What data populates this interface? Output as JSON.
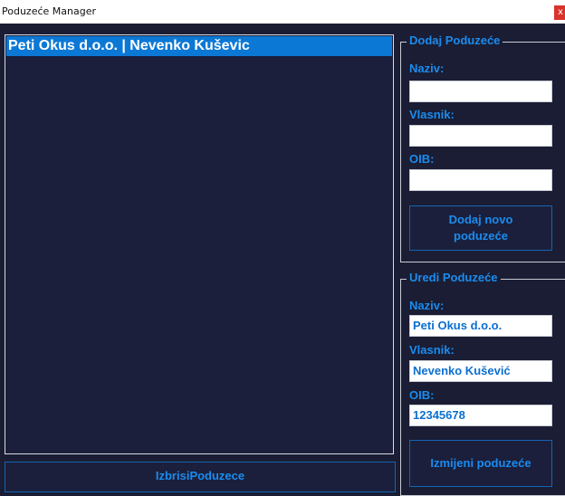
{
  "window": {
    "title": "Poduzeće Manager",
    "close_glyph": "x"
  },
  "companies_list": {
    "items": [
      {
        "label": "Peti Okus d.o.o. | Nevenko Kuševic"
      }
    ]
  },
  "delete_button": {
    "label": "IzbrisiPoduzece"
  },
  "add_group": {
    "title": "Dodaj Poduzeće",
    "name_label": "Naziv:",
    "name_value": "",
    "owner_label": "Vlasnik:",
    "owner_value": "",
    "oib_label": "OIB:",
    "oib_value": "",
    "submit_label": "Dodaj novo poduzeće"
  },
  "edit_group": {
    "title": "Uredi Poduzeće",
    "name_label": "Naziv:",
    "name_value": "Peti Okus d.o.o.",
    "owner_label": "Vlasnik:",
    "owner_value": "Nevenko Kušević",
    "oib_label": "OIB:",
    "oib_value": "12345678",
    "submit_label": "Izmijeni poduzeće"
  },
  "colors": {
    "background": "#1a1d33",
    "accent": "#1a8cf0",
    "selection": "#0b78d6"
  }
}
